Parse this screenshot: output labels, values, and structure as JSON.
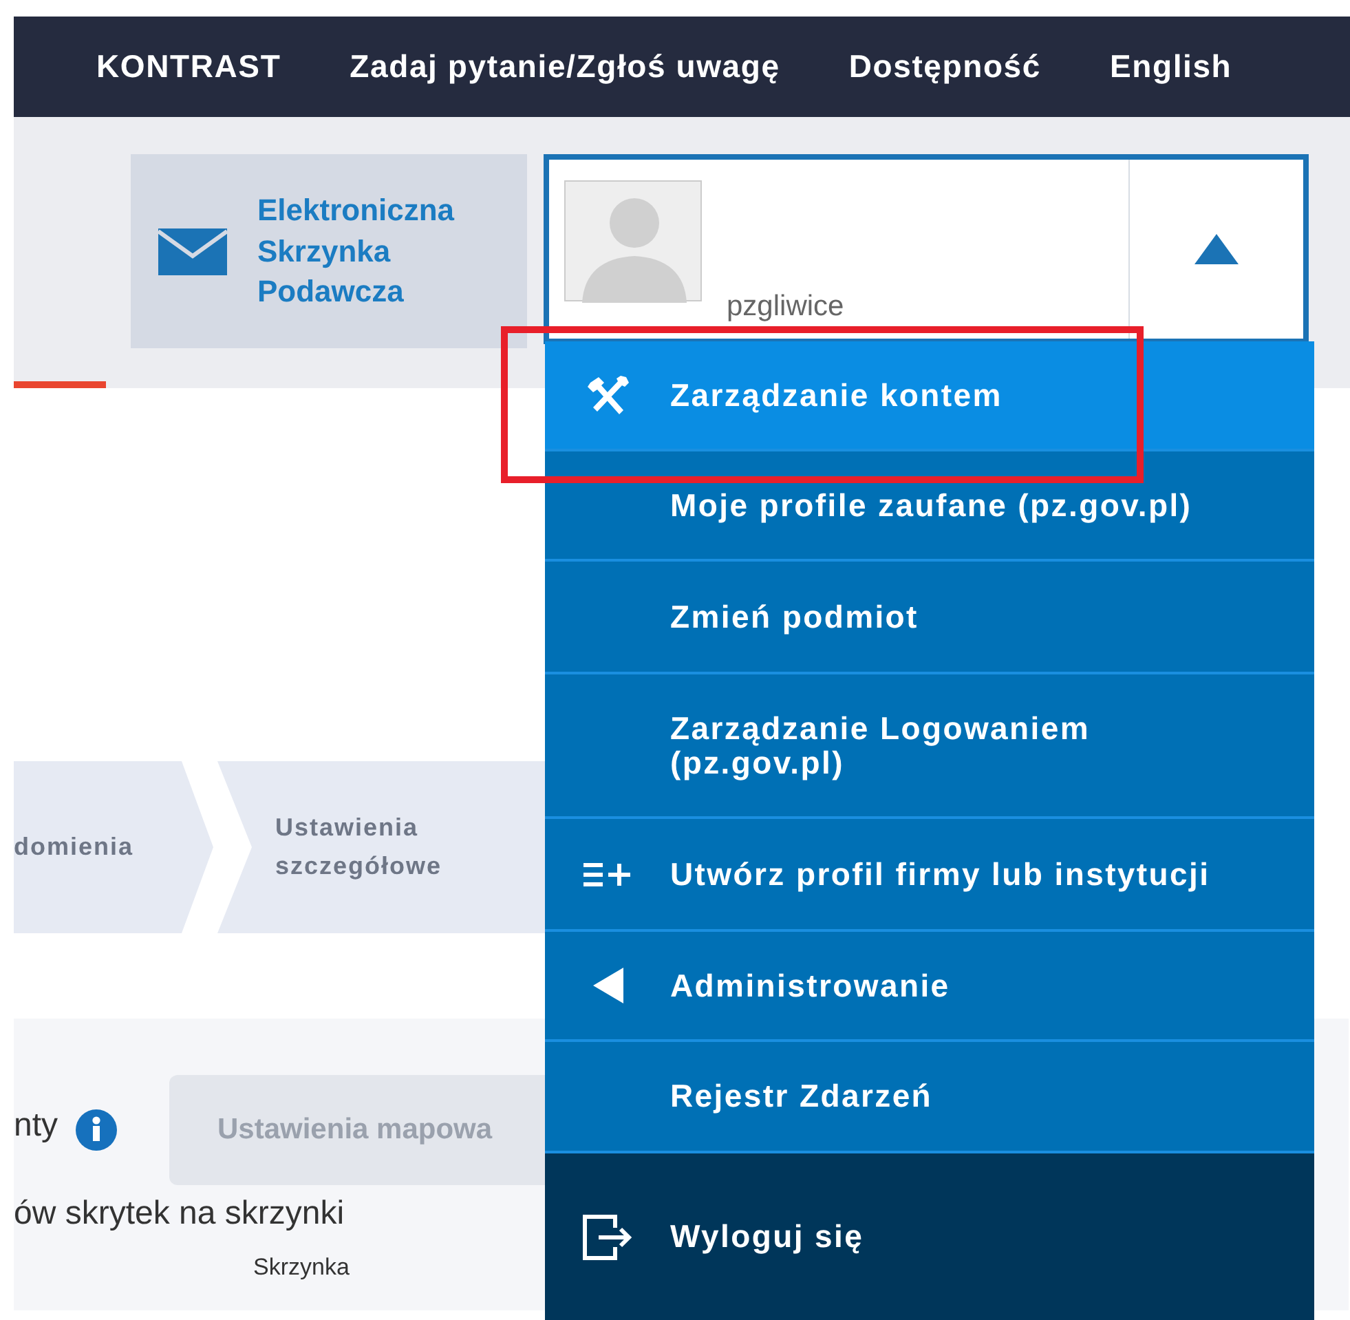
{
  "nav": [
    {
      "label": "KONTRAST"
    },
    {
      "label": "Zadaj pytanie/Zgłoś uwagę"
    },
    {
      "label": "Dostępność"
    },
    {
      "label": "English"
    }
  ],
  "mailbox_button": {
    "label": "Elektroniczna Skrzynka Podawcza"
  },
  "user": {
    "name": "pzgliwice",
    "expanded": true
  },
  "menu": [
    {
      "label": "Zarządzanie kontem",
      "kind": "tools",
      "selected": true
    },
    {
      "label": "Moje profile zaufane (pz.gov.pl)",
      "kind": "plain",
      "selected": false
    },
    {
      "label": "Zmień podmiot",
      "kind": "plain",
      "selected": false
    },
    {
      "label": "Zarządzanie Logowaniem (pz.gov.pl)",
      "kind": "plain",
      "selected": false
    },
    {
      "label": "Utwórz profil firmy lub instytucji",
      "kind": "add",
      "selected": false
    },
    {
      "label": "Administrowanie",
      "kind": "submenu",
      "selected": false
    },
    {
      "label": "Rejestr Zdarzeń",
      "kind": "plain",
      "selected": false
    },
    {
      "label": "Wyloguj się",
      "kind": "logout",
      "selected": false
    }
  ],
  "steps": [
    {
      "label": "domienia"
    },
    {
      "label": "Ustawienia szczegółowe"
    }
  ],
  "settings": {
    "label": "nty",
    "button": {
      "label": "Ustawienia mapowa",
      "disabled": true
    },
    "description": "ów skrytek na skrzynki",
    "column_label": "Skrzynka"
  }
}
